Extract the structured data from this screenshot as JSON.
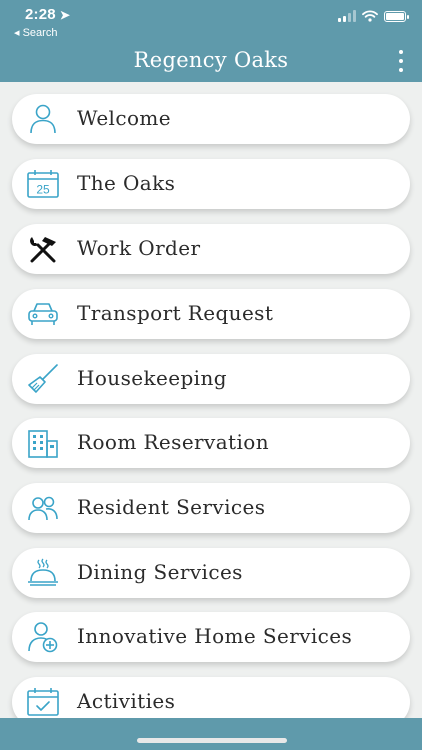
{
  "status_bar": {
    "time": "2:28",
    "location_arrow": "➤",
    "back_label": "◂ Search"
  },
  "header": {
    "title": "Regency Oaks",
    "menu_icon": "more-vertical-icon"
  },
  "colors": {
    "header_bg": "#5f9aab",
    "icon": "#3aa4c8",
    "card_bg": "#ffffff",
    "page_bg": "#eef0ef"
  },
  "menu": {
    "items": [
      {
        "label": "Welcome",
        "icon": "person-icon"
      },
      {
        "label": "The Oaks",
        "icon": "calendar-25-icon",
        "icon_text": "25"
      },
      {
        "label": "Work Order",
        "icon": "hammer-wrench-icon"
      },
      {
        "label": "Transport Request",
        "icon": "car-icon"
      },
      {
        "label": "Housekeeping",
        "icon": "broom-icon"
      },
      {
        "label": "Room Reservation",
        "icon": "building-icon"
      },
      {
        "label": "Resident Services",
        "icon": "people-icon"
      },
      {
        "label": "Dining Services",
        "icon": "cloche-icon"
      },
      {
        "label": "Innovative Home Services",
        "icon": "person-plus-icon"
      },
      {
        "label": "Activities",
        "icon": "calendar-check-icon"
      }
    ]
  }
}
